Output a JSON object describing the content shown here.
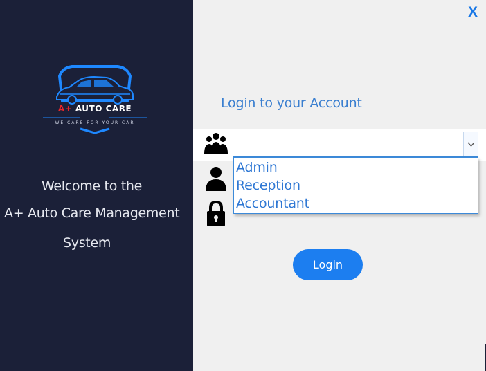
{
  "brand": {
    "logo_prefix": "A+",
    "logo_name": "AUTO CARE",
    "tagline": "WE CARE FOR YOUR CAR",
    "colors": {
      "panel": "#1b2038",
      "logo_blue": "#1e88ff",
      "logo_red": "#e8262a"
    }
  },
  "welcome": {
    "line1": "Welcome to the",
    "line2": "A+ Auto Care Management",
    "line3": "System"
  },
  "window": {
    "close_label": "X"
  },
  "login": {
    "heading": "Login to your Account",
    "role_select": {
      "value": "",
      "icon": "users-group-icon",
      "options": [
        "Admin",
        "Reception",
        "Accountant"
      ]
    },
    "username_icon": "user-icon",
    "password_icon": "lock-icon",
    "button_label": "Login",
    "colors": {
      "accent": "#1c7ef0",
      "heading": "#3a7fd0"
    }
  }
}
